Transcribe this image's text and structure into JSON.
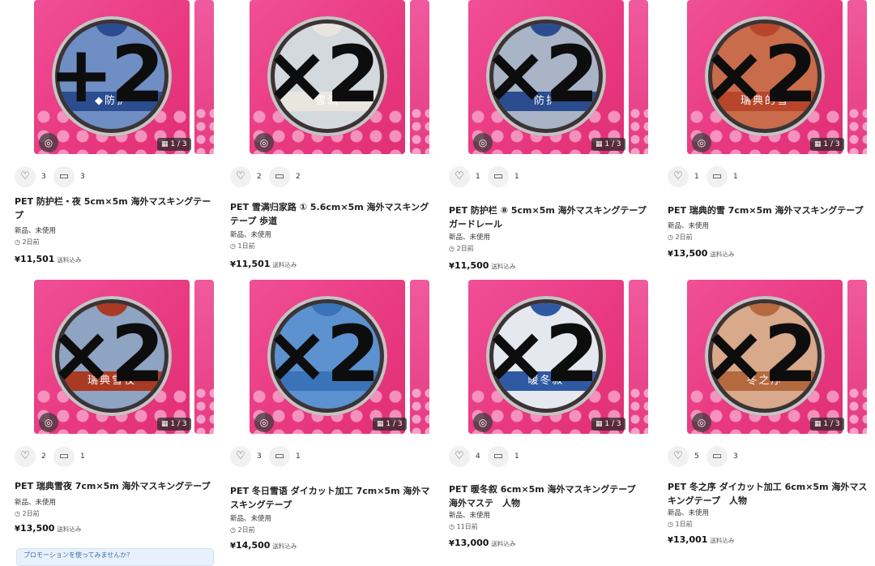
{
  "icons": {
    "heart": "heart-icon",
    "comment": "comment-icon",
    "scan": "image-search-icon",
    "gallery": "gallery-icon",
    "clock": "clock-icon"
  },
  "colors": {
    "pink": "#e8387f",
    "lace": "#f7a1c8",
    "tape_dark": "#3b3436"
  },
  "items": [
    {
      "multiplier": "+2",
      "tape_label": "◆防护",
      "tape_cap": "#2b4d8f",
      "tape_bg": "#6f8fc4",
      "likes": "3",
      "comments": "3",
      "title": "PET 防护栏・夜 5cm×5m 海外マスキングテープ",
      "condition": "新品、未使用",
      "posted": "2日前",
      "price_currency": "¥",
      "price_value": "11,501",
      "shipping": "送料込み",
      "counter": "1 / 3"
    },
    {
      "multiplier": "×2",
      "tape_label": "雪満",
      "tape_cap": "#e9e6df",
      "tape_bg": "#d4d9de",
      "likes": "2",
      "comments": "2",
      "title": "PET 雪满归家路 ① 5.6cm×5m 海外マスキングテープ 歩道",
      "condition": "新品、未使用",
      "posted": "1日前",
      "price_currency": "¥",
      "price_value": "11,501",
      "shipping": "送料込み",
      "counter": ""
    },
    {
      "multiplier": "×2",
      "tape_label": "防护",
      "tape_cap": "#2b4d8f",
      "tape_bg": "#a9b4c6",
      "likes": "1",
      "comments": "1",
      "title": "PET 防护栏 ⑧ 5cm×5m 海外マスキングテープ　ガードレール",
      "condition": "新品、未使用",
      "posted": "2日前",
      "price_currency": "¥",
      "price_value": "11,500",
      "shipping": "送料込み",
      "counter": "1 / 3"
    },
    {
      "multiplier": "×2",
      "tape_label": "瑞典的雪",
      "tape_cap": "#b8462a",
      "tape_bg": "#c96c4c",
      "likes": "1",
      "comments": "1",
      "title": "PET 瑞典的雪 7cm×5m 海外マスキングテープ",
      "condition": "新品、未使用",
      "posted": "2日前",
      "price_currency": "¥",
      "price_value": "13,500",
      "shipping": "送料込み",
      "counter": "1 / 3"
    },
    {
      "multiplier": "×2",
      "tape_label": "瑞典雪夜",
      "tape_cap": "#a93a23",
      "tape_bg": "#8fa3c2",
      "likes": "2",
      "comments": "1",
      "title": "PET 瑞典雪夜 7cm×5m 海外マスキングテープ",
      "condition": "新品、未使用",
      "posted": "2日前",
      "price_currency": "¥",
      "price_value": "13,500",
      "shipping": "送料込み",
      "counter": "1 / 3"
    },
    {
      "multiplier": "×2",
      "tape_label": "",
      "tape_cap": "#3a73b7",
      "tape_bg": "#5b92cf",
      "likes": "3",
      "comments": "1",
      "title": "PET 冬日雪语 ダイカット加工 7cm×5m 海外マスキングテープ",
      "condition": "新品、未使用",
      "posted": "2日前",
      "price_currency": "¥",
      "price_value": "14,500",
      "shipping": "送料込み",
      "counter": "1 / 3"
    },
    {
      "multiplier": "×2",
      "tape_label": "暖冬叙",
      "tape_cap": "#2f5aa3",
      "tape_bg": "#e5e8ef",
      "likes": "4",
      "comments": "1",
      "title": "PET 暖冬叙 6cm×5m 海外マスキングテープ　海外マステ　人物",
      "condition": "新品、未使用",
      "posted": "11日前",
      "price_currency": "¥",
      "price_value": "13,000",
      "shipping": "送料込み",
      "counter": "1 / 3"
    },
    {
      "multiplier": "×2",
      "tape_label": "冬之序",
      "tape_cap": "#b5693f",
      "tape_bg": "#d8a98a",
      "likes": "5",
      "comments": "3",
      "title": "PET 冬之序 ダイカット加工 6cm×5m 海外マスキングテープ　人物",
      "condition": "新品、未使用",
      "posted": "1日前",
      "price_currency": "¥",
      "price_value": "13,001",
      "shipping": "送料込み",
      "counter": "1 / 3"
    }
  ],
  "promo_text": "プロモーションを使ってみませんか？"
}
